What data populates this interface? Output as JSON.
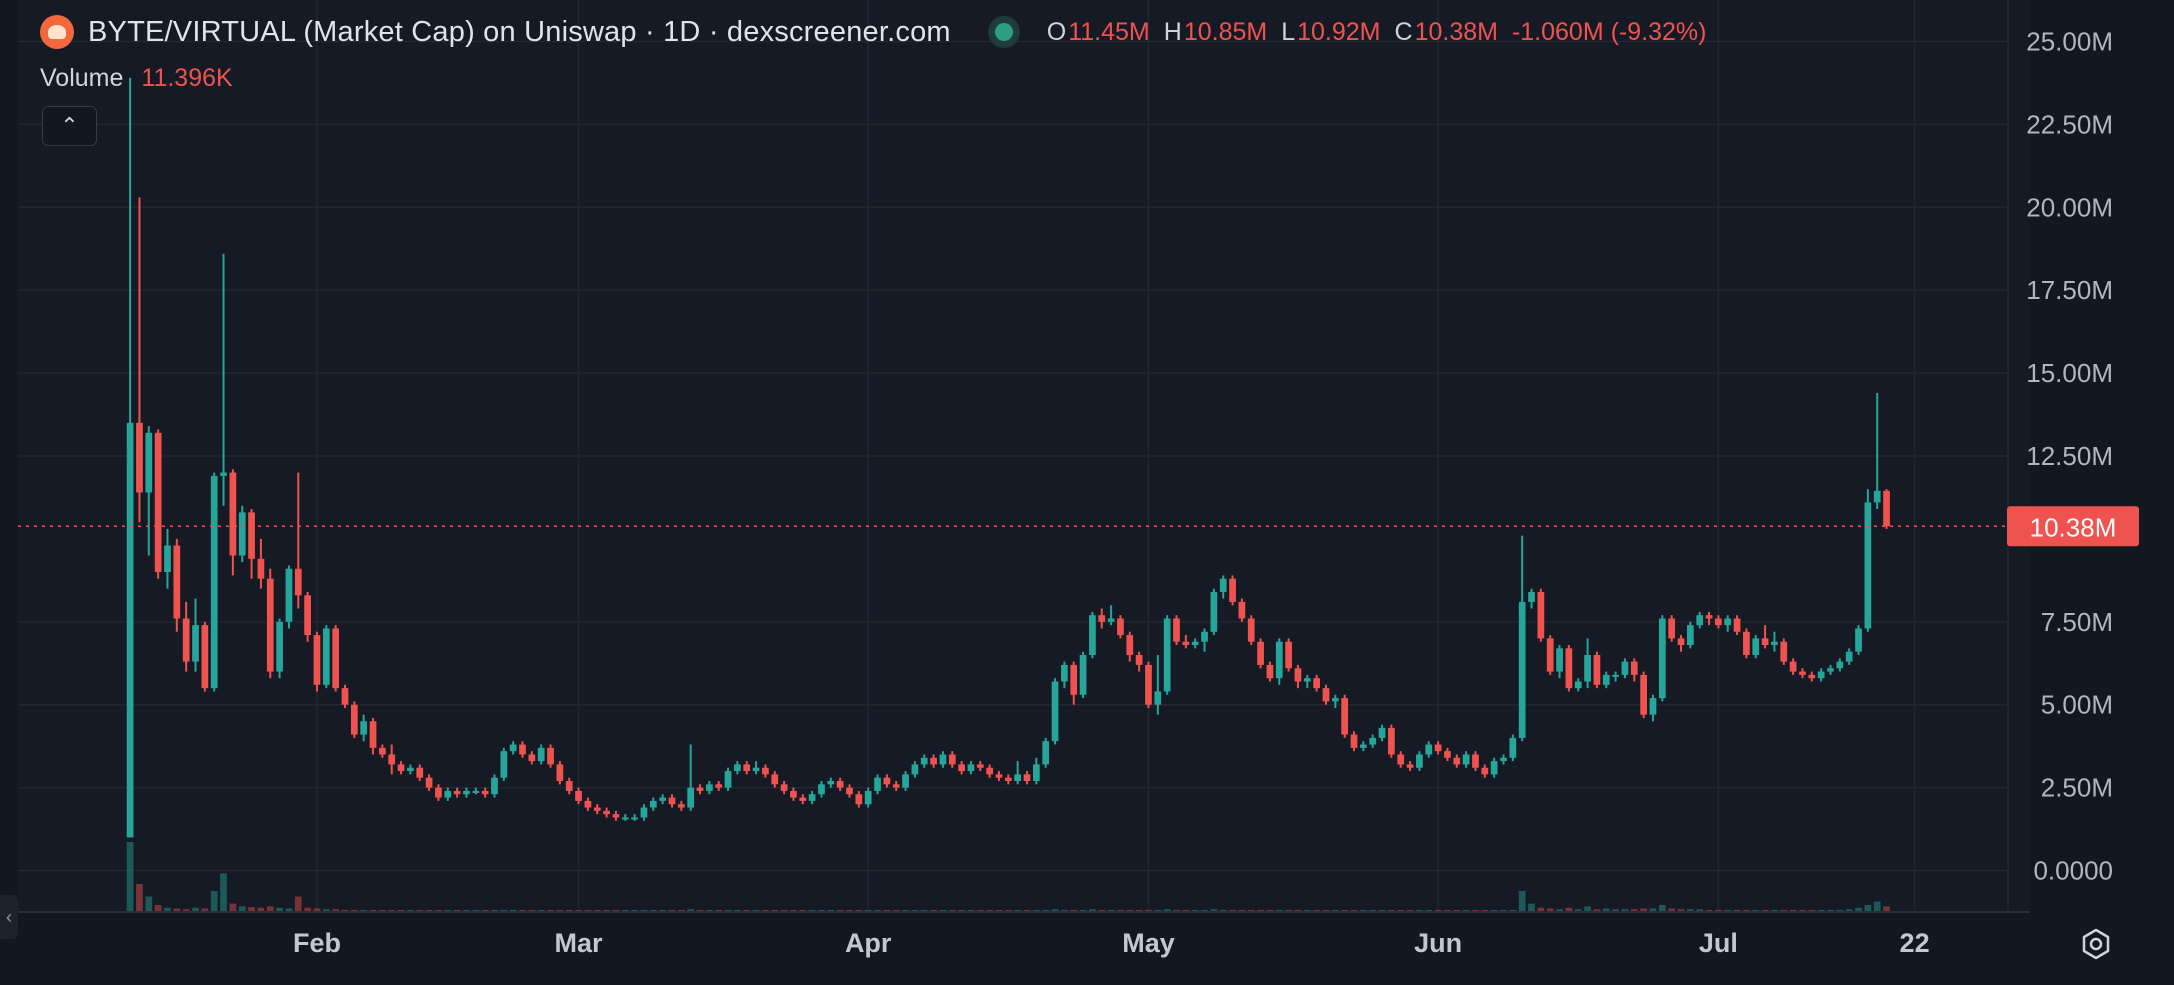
{
  "header": {
    "title": "BYTE/VIRTUAL (Market Cap) on Uniswap · 1D · dexscreener.com",
    "status_color": "#2a9d82",
    "ohlc": [
      {
        "key": "O",
        "value": "11.45M"
      },
      {
        "key": "H",
        "value": "10.85M"
      },
      {
        "key": "L",
        "value": "10.92M"
      },
      {
        "key": "C",
        "value": "10.38M"
      }
    ],
    "change": "-1.060M (-9.32%)"
  },
  "volume": {
    "label": "Volume",
    "value": "11.396K"
  },
  "buttons": {
    "collapse_icon": "chevron-up-icon",
    "collapse_glyph": "⌃",
    "side_glyph": "‹",
    "settings_icon": "settings-icon"
  },
  "colors": {
    "up": "#26a69a",
    "down": "#ef5350",
    "background": "#131722",
    "grid": "#222631"
  },
  "chart_data": {
    "type": "candlestick",
    "title": "BYTE/VIRTUAL (Market Cap) on Uniswap · 1D",
    "y_ticks": [
      "25.00M",
      "22.50M",
      "20.00M",
      "17.50M",
      "15.00M",
      "12.50M",
      "7.50M",
      "5.00M",
      "2.50M",
      "0.0000"
    ],
    "y_tick_values": [
      25,
      22.5,
      20,
      17.5,
      15,
      12.5,
      7.5,
      5,
      2.5,
      0
    ],
    "ylim": [
      -1.25,
      26.25
    ],
    "x_ticks": [
      {
        "label": "Feb",
        "day": 20
      },
      {
        "label": "Mar",
        "day": 48
      },
      {
        "label": "Apr",
        "day": 79
      },
      {
        "label": "May",
        "day": 109
      },
      {
        "label": "Jun",
        "day": 140
      },
      {
        "label": "Jul",
        "day": 170
      },
      {
        "label": "22",
        "day": 191
      }
    ],
    "xlim": [
      -12,
      201
    ],
    "first_candle_day": 0,
    "last_price": {
      "value": 10.38,
      "label": "10.38M"
    },
    "candles": [
      [
        1.0,
        13.5,
        23.9,
        1.0
      ],
      [
        13.5,
        11.4,
        20.3,
        10.5
      ],
      [
        11.4,
        13.2,
        13.4,
        9.5
      ],
      [
        13.2,
        9.0,
        13.3,
        8.8
      ],
      [
        9.0,
        9.8,
        10.3,
        8.5
      ],
      [
        9.8,
        7.6,
        10.0,
        7.2
      ],
      [
        7.6,
        6.3,
        8.1,
        6.0
      ],
      [
        6.3,
        7.4,
        8.2,
        6.0
      ],
      [
        7.4,
        5.5,
        7.5,
        5.4
      ],
      [
        5.5,
        11.9,
        12.0,
        5.4
      ],
      [
        11.9,
        12.0,
        18.6,
        11.0
      ],
      [
        12.0,
        9.5,
        12.1,
        8.9
      ],
      [
        9.5,
        10.8,
        11.0,
        9.3
      ],
      [
        10.8,
        9.4,
        10.9,
        8.8
      ],
      [
        9.4,
        8.8,
        10.0,
        8.5
      ],
      [
        8.8,
        6.0,
        9.1,
        5.8
      ],
      [
        6.0,
        7.5,
        7.6,
        5.8
      ],
      [
        7.5,
        9.1,
        9.2,
        7.3
      ],
      [
        9.1,
        8.3,
        12.0,
        7.9
      ],
      [
        8.3,
        7.1,
        8.4,
        6.9
      ],
      [
        7.1,
        5.6,
        7.2,
        5.4
      ],
      [
        5.6,
        7.3,
        7.4,
        5.5
      ],
      [
        7.3,
        5.5,
        7.4,
        5.4
      ],
      [
        5.5,
        5.0,
        5.6,
        4.9
      ],
      [
        5.0,
        4.1,
        5.1,
        4.0
      ],
      [
        4.1,
        4.5,
        4.7,
        3.9
      ],
      [
        4.5,
        3.7,
        4.6,
        3.5
      ],
      [
        3.7,
        3.5,
        3.8,
        3.4
      ],
      [
        3.5,
        3.2,
        3.8,
        2.9
      ],
      [
        3.2,
        3.0,
        3.3,
        2.9
      ],
      [
        3.0,
        3.1,
        3.2,
        2.9
      ],
      [
        3.1,
        2.8,
        3.2,
        2.7
      ],
      [
        2.8,
        2.5,
        2.9,
        2.4
      ],
      [
        2.5,
        2.2,
        2.6,
        2.1
      ],
      [
        2.2,
        2.4,
        2.5,
        2.1
      ],
      [
        2.4,
        2.3,
        2.5,
        2.2
      ],
      [
        2.3,
        2.4,
        2.5,
        2.2
      ],
      [
        2.4,
        2.4,
        2.5,
        2.3
      ],
      [
        2.4,
        2.3,
        2.5,
        2.2
      ],
      [
        2.3,
        2.8,
        2.9,
        2.2
      ],
      [
        2.8,
        3.6,
        3.7,
        2.7
      ],
      [
        3.6,
        3.8,
        3.9,
        3.5
      ],
      [
        3.8,
        3.5,
        3.9,
        3.4
      ],
      [
        3.5,
        3.3,
        3.6,
        3.2
      ],
      [
        3.3,
        3.7,
        3.8,
        3.2
      ],
      [
        3.7,
        3.2,
        3.8,
        3.1
      ],
      [
        3.2,
        2.7,
        3.3,
        2.6
      ],
      [
        2.7,
        2.4,
        2.8,
        2.3
      ],
      [
        2.4,
        2.1,
        2.5,
        2.0
      ],
      [
        2.1,
        1.9,
        2.2,
        1.8
      ],
      [
        1.9,
        1.8,
        2.0,
        1.7
      ],
      [
        1.8,
        1.7,
        1.9,
        1.6
      ],
      [
        1.7,
        1.6,
        1.8,
        1.5
      ],
      [
        1.6,
        1.6,
        1.7,
        1.5
      ],
      [
        1.6,
        1.6,
        1.7,
        1.5
      ],
      [
        1.6,
        1.9,
        2.0,
        1.5
      ],
      [
        1.9,
        2.1,
        2.2,
        1.8
      ],
      [
        2.1,
        2.2,
        2.3,
        2.0
      ],
      [
        2.2,
        2.0,
        2.3,
        1.9
      ],
      [
        2.0,
        1.9,
        2.1,
        1.8
      ],
      [
        1.9,
        2.5,
        3.8,
        1.8
      ],
      [
        2.5,
        2.4,
        2.6,
        2.3
      ],
      [
        2.4,
        2.6,
        2.7,
        2.3
      ],
      [
        2.6,
        2.5,
        2.7,
        2.4
      ],
      [
        2.5,
        3.0,
        3.1,
        2.4
      ],
      [
        3.0,
        3.2,
        3.3,
        2.9
      ],
      [
        3.2,
        3.0,
        3.3,
        2.9
      ],
      [
        3.0,
        3.1,
        3.3,
        2.9
      ],
      [
        3.1,
        2.9,
        3.2,
        2.8
      ],
      [
        2.9,
        2.6,
        3.0,
        2.5
      ],
      [
        2.6,
        2.4,
        2.7,
        2.3
      ],
      [
        2.4,
        2.2,
        2.5,
        2.1
      ],
      [
        2.2,
        2.1,
        2.3,
        2.0
      ],
      [
        2.1,
        2.3,
        2.4,
        2.0
      ],
      [
        2.3,
        2.6,
        2.7,
        2.2
      ],
      [
        2.6,
        2.7,
        2.8,
        2.5
      ],
      [
        2.7,
        2.5,
        2.8,
        2.4
      ],
      [
        2.5,
        2.3,
        2.6,
        2.2
      ],
      [
        2.3,
        2.0,
        2.4,
        1.9
      ],
      [
        2.0,
        2.4,
        2.5,
        1.9
      ],
      [
        2.4,
        2.8,
        2.9,
        2.3
      ],
      [
        2.8,
        2.6,
        2.9,
        2.5
      ],
      [
        2.6,
        2.5,
        2.7,
        2.4
      ],
      [
        2.5,
        2.9,
        3.0,
        2.4
      ],
      [
        2.9,
        3.2,
        3.3,
        2.8
      ],
      [
        3.2,
        3.4,
        3.5,
        3.1
      ],
      [
        3.4,
        3.2,
        3.5,
        3.1
      ],
      [
        3.2,
        3.5,
        3.6,
        3.1
      ],
      [
        3.5,
        3.2,
        3.6,
        3.1
      ],
      [
        3.2,
        3.0,
        3.3,
        2.9
      ],
      [
        3.0,
        3.2,
        3.3,
        2.9
      ],
      [
        3.2,
        3.1,
        3.3,
        3.0
      ],
      [
        3.1,
        2.9,
        3.2,
        2.8
      ],
      [
        2.9,
        2.8,
        3.0,
        2.7
      ],
      [
        2.8,
        2.7,
        2.9,
        2.6
      ],
      [
        2.7,
        2.9,
        3.3,
        2.6
      ],
      [
        2.9,
        2.7,
        3.0,
        2.6
      ],
      [
        2.7,
        3.2,
        3.4,
        2.6
      ],
      [
        3.2,
        3.9,
        4.0,
        3.1
      ],
      [
        3.9,
        5.7,
        5.8,
        3.8
      ],
      [
        5.7,
        6.2,
        6.3,
        5.5
      ],
      [
        6.2,
        5.3,
        6.3,
        5.0
      ],
      [
        5.3,
        6.5,
        6.6,
        5.2
      ],
      [
        6.5,
        7.7,
        7.8,
        6.4
      ],
      [
        7.7,
        7.5,
        7.9,
        7.3
      ],
      [
        7.5,
        7.6,
        8.0,
        7.4
      ],
      [
        7.6,
        7.1,
        7.7,
        7.0
      ],
      [
        7.1,
        6.5,
        7.2,
        6.3
      ],
      [
        6.5,
        6.2,
        6.6,
        6.0
      ],
      [
        6.2,
        5.0,
        6.3,
        4.9
      ],
      [
        5.0,
        5.4,
        6.5,
        4.7
      ],
      [
        5.4,
        7.6,
        7.7,
        5.3
      ],
      [
        7.6,
        6.9,
        7.7,
        6.8
      ],
      [
        6.9,
        6.8,
        7.1,
        6.7
      ],
      [
        6.8,
        6.9,
        7.0,
        6.7
      ],
      [
        6.9,
        7.2,
        7.3,
        6.6
      ],
      [
        7.2,
        8.4,
        8.5,
        7.1
      ],
      [
        8.4,
        8.8,
        8.9,
        8.2
      ],
      [
        8.8,
        8.1,
        8.9,
        8.0
      ],
      [
        8.1,
        7.6,
        8.2,
        7.5
      ],
      [
        7.6,
        6.9,
        7.7,
        6.8
      ],
      [
        6.9,
        6.2,
        7.0,
        6.1
      ],
      [
        6.2,
        5.8,
        6.3,
        5.7
      ],
      [
        5.8,
        6.9,
        7.0,
        5.6
      ],
      [
        6.9,
        6.1,
        7.0,
        6.0
      ],
      [
        6.1,
        5.7,
        6.2,
        5.5
      ],
      [
        5.7,
        5.8,
        5.9,
        5.5
      ],
      [
        5.8,
        5.5,
        5.9,
        5.4
      ],
      [
        5.5,
        5.1,
        5.6,
        5.0
      ],
      [
        5.1,
        5.2,
        5.3,
        4.9
      ],
      [
        5.2,
        4.1,
        5.3,
        4.0
      ],
      [
        4.1,
        3.7,
        4.2,
        3.6
      ],
      [
        3.7,
        3.8,
        3.9,
        3.6
      ],
      [
        3.8,
        4.0,
        4.1,
        3.7
      ],
      [
        4.0,
        4.3,
        4.4,
        3.9
      ],
      [
        4.3,
        3.5,
        4.4,
        3.4
      ],
      [
        3.5,
        3.2,
        3.6,
        3.1
      ],
      [
        3.2,
        3.1,
        3.3,
        3.0
      ],
      [
        3.1,
        3.5,
        3.6,
        3.0
      ],
      [
        3.5,
        3.8,
        3.9,
        3.4
      ],
      [
        3.8,
        3.6,
        3.9,
        3.5
      ],
      [
        3.6,
        3.4,
        3.7,
        3.3
      ],
      [
        3.4,
        3.2,
        3.5,
        3.1
      ],
      [
        3.2,
        3.5,
        3.6,
        3.1
      ],
      [
        3.5,
        3.1,
        3.6,
        3.0
      ],
      [
        3.1,
        2.9,
        3.2,
        2.8
      ],
      [
        2.9,
        3.3,
        3.4,
        2.8
      ],
      [
        3.3,
        3.4,
        3.5,
        3.2
      ],
      [
        3.4,
        4.0,
        4.1,
        3.3
      ],
      [
        4.0,
        8.1,
        10.1,
        3.9
      ],
      [
        8.1,
        8.4,
        8.5,
        7.9
      ],
      [
        8.4,
        7.0,
        8.5,
        6.9
      ],
      [
        7.0,
        6.0,
        7.1,
        5.9
      ],
      [
        6.0,
        6.7,
        6.8,
        5.8
      ],
      [
        6.7,
        5.5,
        6.8,
        5.4
      ],
      [
        5.5,
        5.7,
        5.8,
        5.4
      ],
      [
        5.7,
        6.5,
        7.0,
        5.5
      ],
      [
        6.5,
        5.6,
        6.6,
        5.5
      ],
      [
        5.6,
        5.9,
        6.0,
        5.5
      ],
      [
        5.9,
        5.9,
        6.0,
        5.7
      ],
      [
        5.9,
        6.3,
        6.4,
        5.8
      ],
      [
        6.3,
        5.9,
        6.4,
        5.7
      ],
      [
        5.9,
        4.7,
        6.0,
        4.6
      ],
      [
        4.7,
        5.2,
        5.3,
        4.5
      ],
      [
        5.2,
        7.6,
        7.7,
        5.1
      ],
      [
        7.6,
        7.0,
        7.7,
        6.9
      ],
      [
        7.0,
        6.8,
        7.1,
        6.6
      ],
      [
        6.8,
        7.4,
        7.5,
        6.7
      ],
      [
        7.4,
        7.7,
        7.8,
        7.3
      ],
      [
        7.7,
        7.6,
        7.8,
        7.4
      ],
      [
        7.6,
        7.4,
        7.7,
        7.3
      ],
      [
        7.4,
        7.6,
        7.7,
        7.2
      ],
      [
        7.6,
        7.2,
        7.7,
        7.1
      ],
      [
        7.2,
        6.5,
        7.3,
        6.4
      ],
      [
        6.5,
        7.0,
        7.1,
        6.4
      ],
      [
        7.0,
        6.8,
        7.4,
        6.7
      ],
      [
        6.8,
        6.9,
        7.2,
        6.6
      ],
      [
        6.9,
        6.3,
        7.0,
        6.2
      ],
      [
        6.3,
        6.0,
        6.4,
        5.9
      ],
      [
        6.0,
        5.9,
        6.1,
        5.8
      ],
      [
        5.9,
        5.8,
        6.0,
        5.7
      ],
      [
        5.8,
        6.0,
        6.1,
        5.7
      ],
      [
        6.0,
        6.1,
        6.2,
        5.9
      ],
      [
        6.1,
        6.3,
        6.4,
        6.0
      ],
      [
        6.3,
        6.6,
        6.7,
        6.2
      ],
      [
        6.6,
        7.3,
        7.4,
        6.5
      ],
      [
        7.3,
        11.1,
        11.5,
        7.2
      ],
      [
        11.1,
        11.45,
        14.4,
        10.9
      ],
      [
        11.45,
        10.38,
        11.5,
        10.3
      ]
    ],
    "volumes": [
      1.0,
      0.4,
      0.22,
      0.1,
      0.06,
      0.05,
      0.04,
      0.06,
      0.05,
      0.3,
      0.55,
      0.12,
      0.08,
      0.07,
      0.06,
      0.08,
      0.06,
      0.05,
      0.22,
      0.06,
      0.05,
      0.04,
      0.04,
      0.03,
      0.03,
      0.02,
      0.03,
      0.02,
      0.02,
      0.02,
      0.02,
      0.02,
      0.02,
      0.02,
      0.02,
      0.02,
      0.02,
      0.02,
      0.02,
      0.03,
      0.03,
      0.03,
      0.02,
      0.02,
      0.02,
      0.02,
      0.02,
      0.02,
      0.02,
      0.02,
      0.02,
      0.02,
      0.02,
      0.02,
      0.02,
      0.02,
      0.02,
      0.02,
      0.02,
      0.02,
      0.04,
      0.02,
      0.02,
      0.02,
      0.02,
      0.02,
      0.02,
      0.02,
      0.02,
      0.02,
      0.02,
      0.02,
      0.02,
      0.02,
      0.02,
      0.02,
      0.02,
      0.02,
      0.02,
      0.02,
      0.02,
      0.02,
      0.02,
      0.02,
      0.02,
      0.02,
      0.02,
      0.02,
      0.02,
      0.02,
      0.02,
      0.02,
      0.02,
      0.02,
      0.02,
      0.02,
      0.02,
      0.02,
      0.03,
      0.04,
      0.03,
      0.03,
      0.03,
      0.04,
      0.03,
      0.03,
      0.03,
      0.03,
      0.03,
      0.03,
      0.03,
      0.04,
      0.03,
      0.03,
      0.03,
      0.03,
      0.04,
      0.03,
      0.03,
      0.03,
      0.03,
      0.03,
      0.03,
      0.03,
      0.03,
      0.03,
      0.02,
      0.02,
      0.02,
      0.02,
      0.02,
      0.02,
      0.02,
      0.02,
      0.02,
      0.02,
      0.02,
      0.02,
      0.02,
      0.02,
      0.02,
      0.02,
      0.02,
      0.02,
      0.02,
      0.02,
      0.02,
      0.02,
      0.03,
      0.3,
      0.12,
      0.06,
      0.05,
      0.04,
      0.06,
      0.04,
      0.08,
      0.04,
      0.05,
      0.04,
      0.04,
      0.04,
      0.05,
      0.05,
      0.1,
      0.05,
      0.04,
      0.04,
      0.04,
      0.03,
      0.03,
      0.03,
      0.03,
      0.03,
      0.03,
      0.03,
      0.03,
      0.03,
      0.03,
      0.03,
      0.03,
      0.03,
      0.03,
      0.03,
      0.04,
      0.06,
      0.1,
      0.15,
      0.08
    ]
  }
}
